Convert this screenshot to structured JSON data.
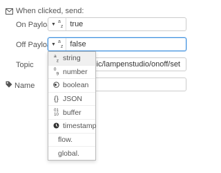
{
  "section": {
    "title": "When clicked, send:"
  },
  "on_payload": {
    "label": "On Payload",
    "type_icon": "az",
    "value": "true"
  },
  "off_payload": {
    "label": "Off Payload",
    "type_icon": "az",
    "value": "false"
  },
  "topic": {
    "label": "Topic",
    "value": "pic/lampenstudio/onoff/set"
  },
  "name": {
    "label": "Name",
    "value": ""
  },
  "type_menu": {
    "items": [
      {
        "label": "string",
        "icon": "az"
      },
      {
        "label": "number",
        "icon": "09"
      },
      {
        "label": "boolean",
        "icon": "toggle"
      },
      {
        "label": "JSON",
        "icon": "{}"
      },
      {
        "label": "buffer",
        "icon": "0110"
      },
      {
        "label": "timestamp",
        "icon": "clock"
      },
      {
        "label": "flow.",
        "icon": ""
      },
      {
        "label": "global.",
        "icon": ""
      }
    ]
  },
  "colors": {
    "focus_border": "#3b8ede",
    "border": "#cccccc",
    "text": "#555555"
  }
}
